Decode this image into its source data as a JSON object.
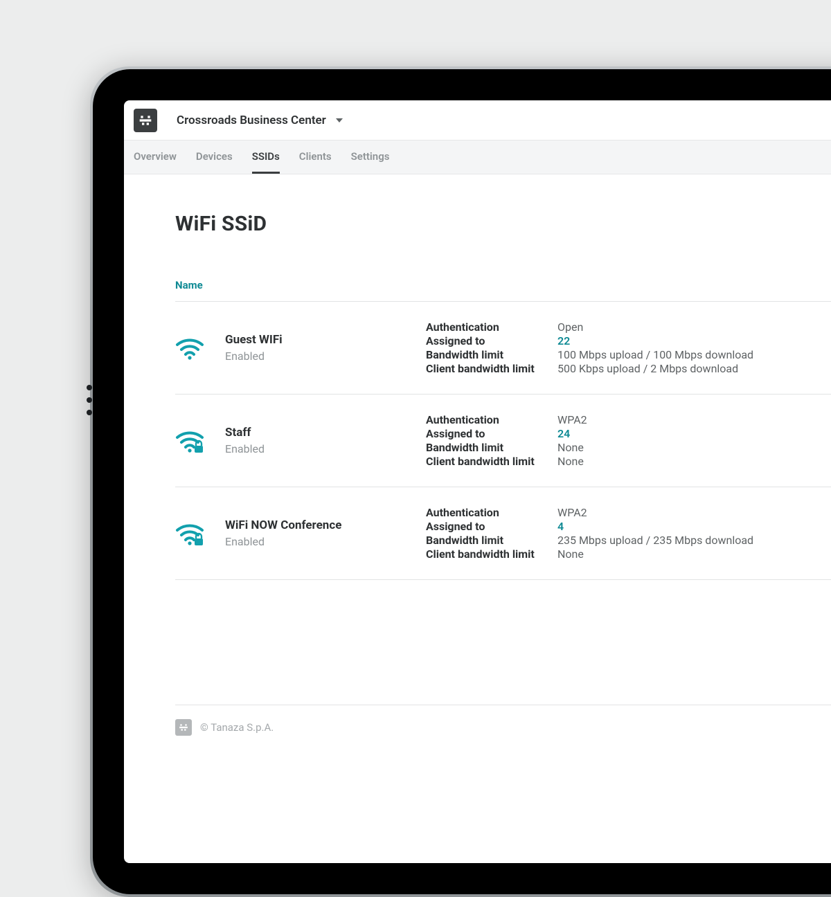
{
  "header": {
    "network_name": "Crossroads Business Center"
  },
  "tabs": [
    {
      "label": "Overview",
      "active": false
    },
    {
      "label": "Devices",
      "active": false
    },
    {
      "label": "SSIDs",
      "active": true
    },
    {
      "label": "Clients",
      "active": false
    },
    {
      "label": "Settings",
      "active": false
    }
  ],
  "page": {
    "title": "WiFi SSiD"
  },
  "table": {
    "column_header": "Name",
    "field_labels": {
      "authentication": "Authentication",
      "assigned_to": "Assigned to",
      "bandwidth_limit": "Bandwidth limit",
      "client_bandwidth_limit": "Client bandwidth limit"
    }
  },
  "ssids": [
    {
      "name": "Guest WIFi",
      "status": "Enabled",
      "secured": false,
      "authentication": "Open",
      "assigned_to": "22",
      "bandwidth_limit": "100 Mbps upload / 100 Mbps download",
      "client_bandwidth_limit": "500 Kbps upload / 2 Mbps download"
    },
    {
      "name": "Staff",
      "status": "Enabled",
      "secured": true,
      "authentication": "WPA2",
      "assigned_to": "24",
      "bandwidth_limit": "None",
      "client_bandwidth_limit": "None"
    },
    {
      "name": "WiFi NOW Conference",
      "status": "Enabled",
      "secured": true,
      "authentication": "WPA2",
      "assigned_to": "4",
      "bandwidth_limit": "235 Mbps upload / 235 Mbps download",
      "client_bandwidth_limit": "None"
    }
  ],
  "footer": {
    "copyright": "© Tanaza S.p.A."
  },
  "colors": {
    "accent": "#12a0ad",
    "text": "#2e3133",
    "muted": "#8f9497"
  },
  "icons": {
    "wifi": "wifi-icon",
    "wifi_secured": "wifi-secured-icon",
    "chevron_down": "chevron-down-icon",
    "brand": "brand-logo-icon"
  }
}
